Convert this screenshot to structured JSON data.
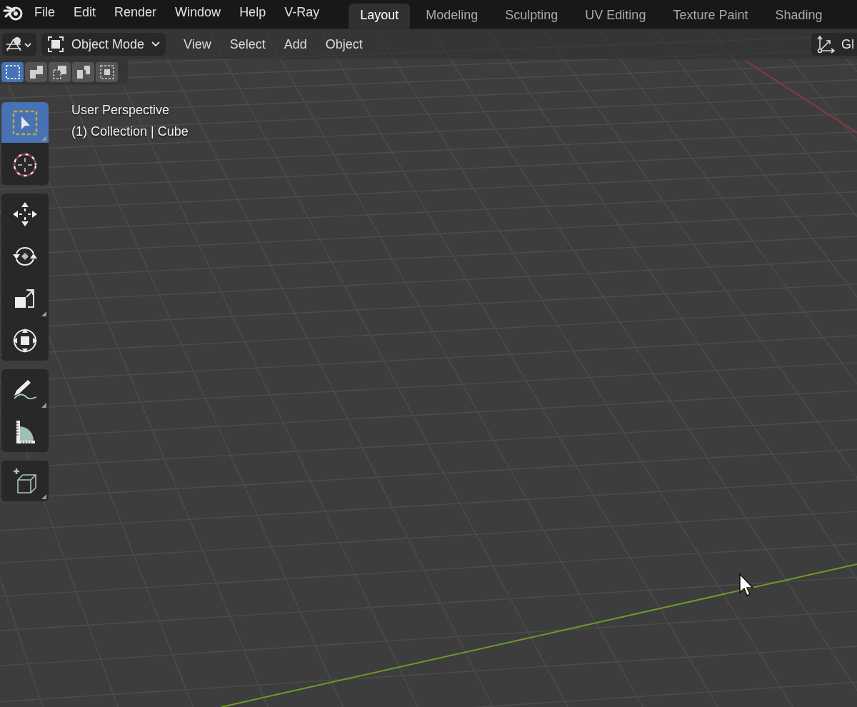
{
  "top_bar": {
    "menus": [
      "File",
      "Edit",
      "Render",
      "Window",
      "Help",
      "V-Ray"
    ],
    "workspace_tabs": [
      {
        "label": "Layout",
        "selected": true
      },
      {
        "label": "Modeling",
        "selected": false
      },
      {
        "label": "Sculpting",
        "selected": false
      },
      {
        "label": "UV Editing",
        "selected": false
      },
      {
        "label": "Texture Paint",
        "selected": false
      },
      {
        "label": "Shading",
        "selected": false
      }
    ]
  },
  "viewport_header": {
    "mode": "Object Mode",
    "menus": [
      "View",
      "Select",
      "Add",
      "Object"
    ],
    "orientation": "Gl"
  },
  "select_modes": [
    {
      "selected": true
    },
    {
      "selected": false
    },
    {
      "selected": false
    },
    {
      "selected": false
    },
    {
      "selected": false
    }
  ],
  "tool_groups": [
    {
      "tools": [
        {
          "selected": true,
          "submenu": true
        },
        {
          "selected": false,
          "submenu": false
        }
      ]
    },
    {
      "tools": [
        {
          "selected": false,
          "submenu": false
        },
        {
          "selected": false,
          "submenu": false
        },
        {
          "selected": false,
          "submenu": true
        },
        {
          "selected": false,
          "submenu": false
        }
      ]
    },
    {
      "tools": [
        {
          "selected": false,
          "submenu": true
        },
        {
          "selected": false,
          "submenu": false
        }
      ]
    },
    {
      "tools": [
        {
          "selected": false,
          "submenu": true
        }
      ]
    }
  ],
  "overlay": {
    "view_name": "User Perspective",
    "object_info": "(1) Collection | Cube"
  }
}
